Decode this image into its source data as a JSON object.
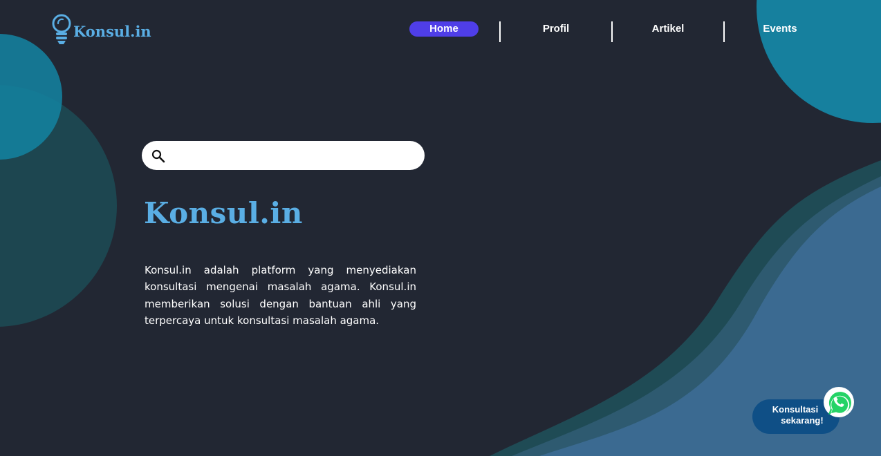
{
  "brand": {
    "name": "Konsul.in",
    "accent_color": "#5aaee4"
  },
  "nav": {
    "items": [
      {
        "label": "Home",
        "active": true
      },
      {
        "label": "Profil",
        "active": false
      },
      {
        "label": "Artikel",
        "active": false
      },
      {
        "label": "Events",
        "active": false
      }
    ],
    "active_color": "#4f3ee8"
  },
  "search": {
    "value": "",
    "placeholder": "",
    "icon": "search-icon"
  },
  "hero": {
    "title": "Konsul.in",
    "description": "Konsul.in adalah platform yang menyediakan konsultasi mengenai masalah agama. Konsul.in memberikan solusi dengan bantuan ahli yang terpercaya untuk konsultasi masalah agama."
  },
  "whatsapp_cta": {
    "line1": "Konsultasi",
    "line2": "sekarang!",
    "icon": "whatsapp-icon",
    "color": "#0f4f86"
  },
  "colors": {
    "background": "#222733",
    "teal": "#1a8aa6",
    "dark_teal": "#1d4a55",
    "steel_blue": "#3b6a91"
  }
}
